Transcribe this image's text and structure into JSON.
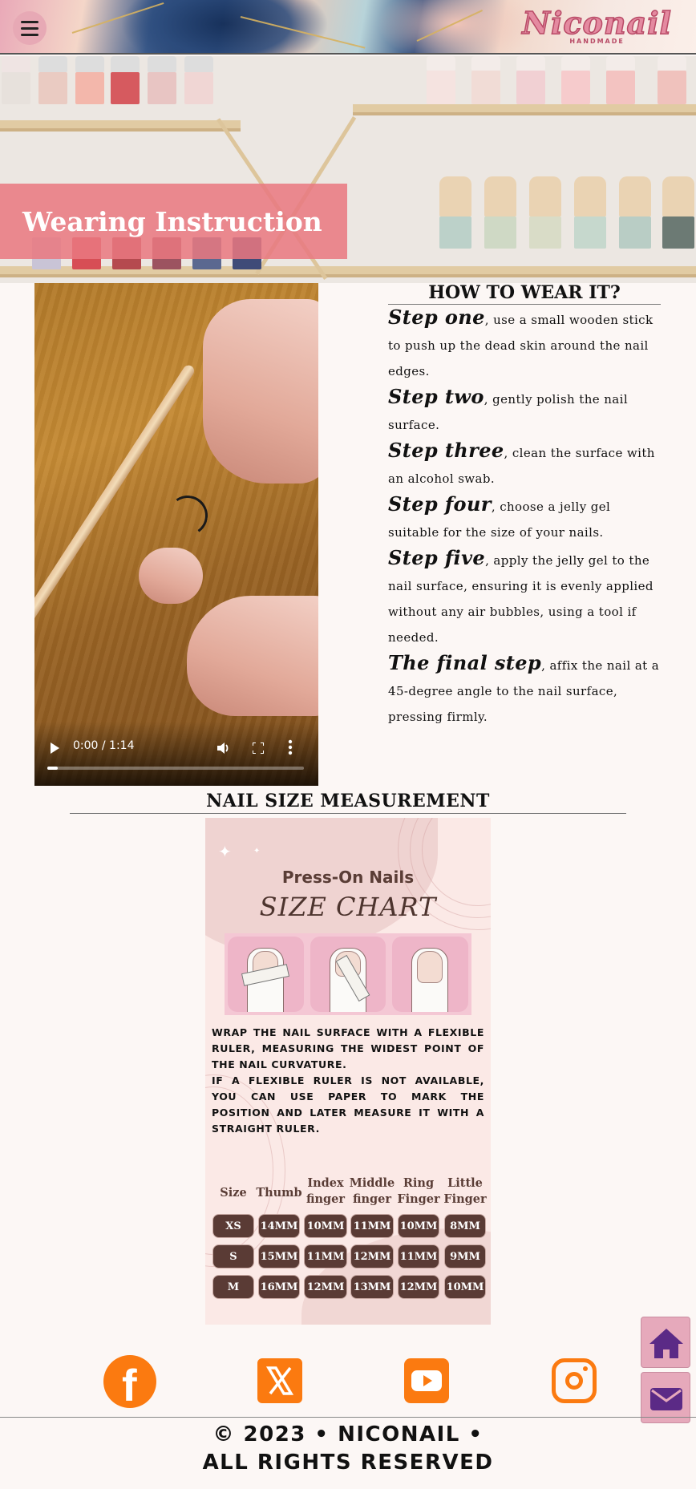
{
  "header": {
    "logo_text": "Niconail",
    "logo_sub": "HANDMADE",
    "menu_icon": "hamburger-menu-icon"
  },
  "hero": {
    "title": "Wearing Instruction"
  },
  "video": {
    "time": "0:00 / 1:14",
    "progress": 0.0,
    "icons": [
      "play-icon",
      "volume-icon",
      "fullscreen-icon",
      "more-options-icon"
    ]
  },
  "howto": {
    "title": "HOW TO WEAR IT?",
    "steps": [
      {
        "lead": "Step one",
        "text": ", use a small wooden stick to push up the dead skin around the nail edges."
      },
      {
        "lead": "Step two",
        "text": ", gently polish the nail surface."
      },
      {
        "lead": "Step three",
        "text": ", clean the surface with an alcohol swab."
      },
      {
        "lead": "Step four",
        "text": ", choose a jelly gel suitable for the size of your nails."
      },
      {
        "lead": "Step five",
        "text": ", apply the jelly gel to the nail surface, ensuring it is evenly applied without any air bubbles, using a tool if needed."
      },
      {
        "lead": "The final step",
        "text": ", affix the nail at a 45-degree angle to the nail surface, pressing firmly."
      }
    ]
  },
  "size_section": {
    "title": "NAIL SIZE MEASUREMENT",
    "chart_title": "Press-On Nails",
    "chart_subtitle": "SIZE CHART",
    "instructions_1": "WRAP THE NAIL SURFACE WITH A FLEXIBLE RULER, MEASURING THE WIDEST POINT OF THE NAIL CURVATURE.",
    "instructions_2": "IF A FLEXIBLE RULER IS NOT AVAILABLE, YOU CAN USE PAPER TO MARK THE POSITION AND LATER MEASURE IT WITH A STRAIGHT RULER.",
    "columns": [
      "Size",
      "Thumb",
      "Index finger",
      "Middle finger",
      "Ring Finger",
      "Little Finger"
    ],
    "rows": [
      [
        "XS",
        "14MM",
        "10MM",
        "11MM",
        "10MM",
        "8MM"
      ],
      [
        "S",
        "15MM",
        "11MM",
        "12MM",
        "11MM",
        "9MM"
      ],
      [
        "M",
        "16MM",
        "12MM",
        "13MM",
        "12MM",
        "10MM"
      ]
    ]
  },
  "social": {
    "facebook": "facebook-icon",
    "x": "x-twitter-icon",
    "youtube": "youtube-icon",
    "instagram": "instagram-icon",
    "accent": "#fb7a10"
  },
  "floating": {
    "home": "home-icon",
    "mail": "mail-icon",
    "accent": "#e6a9bb"
  },
  "footer": {
    "line1": "© 2023 • NICONAIL •",
    "line2": "ALL RIGHTS RESERVED"
  }
}
